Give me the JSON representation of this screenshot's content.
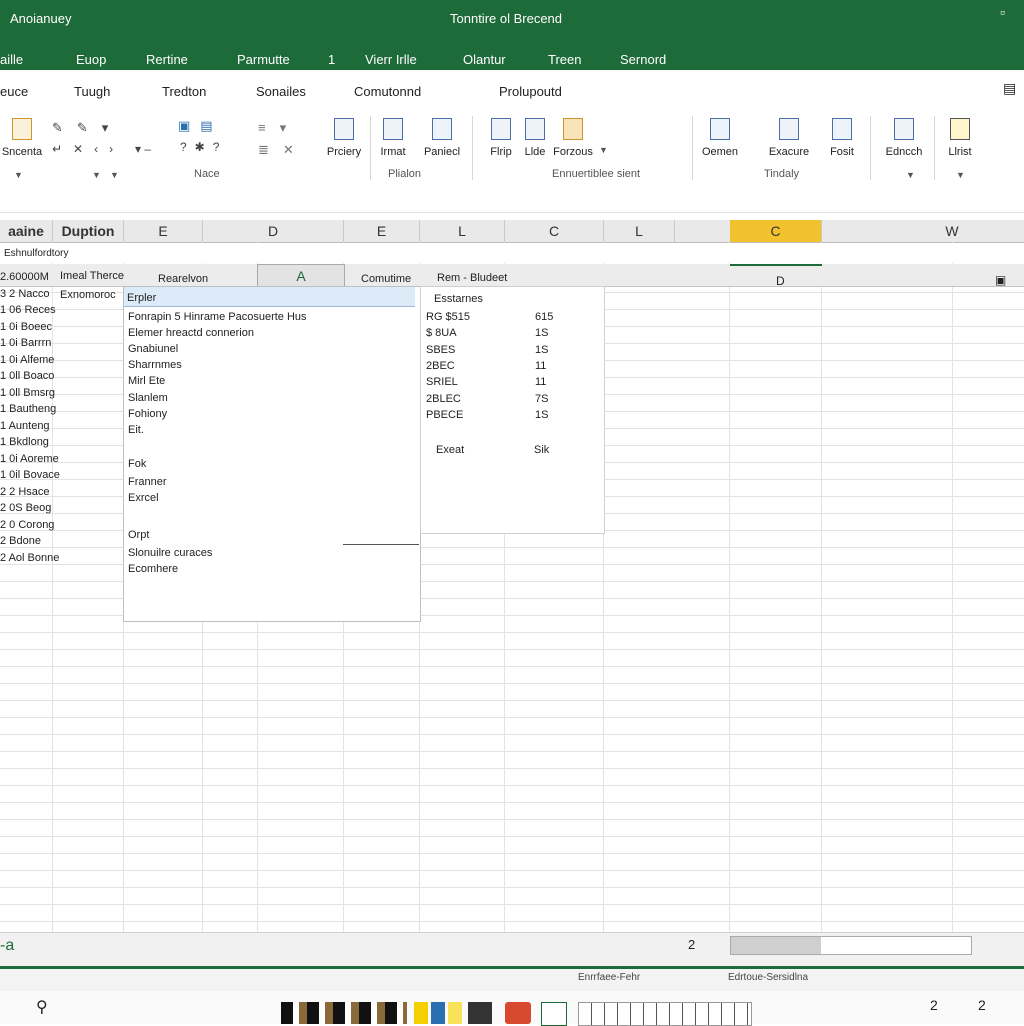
{
  "window": {
    "app_name": "Anoianuey",
    "title": "Tonntire ol Brecend"
  },
  "menu_tabs": [
    "aille",
    "Euop",
    "Rertine",
    "Parmutte",
    "1",
    "Vierr Irlle",
    "Olantur",
    "Treen",
    "Sernord"
  ],
  "ribbon_tabs": [
    "euce",
    "Tuugh",
    "Tredton",
    "Sonailes",
    "Comutonnd",
    "Prolupoutd"
  ],
  "ribbon": {
    "buttons": [
      {
        "label": "Sncenta",
        "icon": "paste-icon"
      },
      {
        "label": "Prciery",
        "icon": "table-icon"
      },
      {
        "label": "Irmat",
        "icon": "format-icon"
      },
      {
        "label": "Paniecl",
        "icon": "panel-icon"
      },
      {
        "label": "Flrip",
        "icon": "chart-icon"
      },
      {
        "label": "Llde",
        "icon": "chart-bars-icon"
      },
      {
        "label": "Forzous",
        "icon": "folder-icon"
      },
      {
        "label": "Oemen",
        "icon": "document-icon"
      },
      {
        "label": "Exacure",
        "icon": "grid-icon"
      },
      {
        "label": "Fosit",
        "icon": "sheet-icon"
      },
      {
        "label": "Edncch",
        "icon": "page-icon"
      },
      {
        "label": "Llrist",
        "icon": "note-icon"
      }
    ],
    "groups": [
      "Nace",
      "Plialon",
      "Ennuertiblee sient",
      "Tindaly"
    ]
  },
  "name_box": "Eshnulfordtory",
  "column_headers": [
    "aaine",
    "Duption",
    "E",
    "D",
    "E",
    "L",
    "C",
    "L",
    "C",
    "W"
  ],
  "subheaders": {
    "a": "Imeal Therce",
    "b": "Rearelvon",
    "c": "A",
    "d": "Comutime",
    "e": "Rem - Bludeet",
    "f": "D"
  },
  "row_labels": [
    "2.60000M",
    "3 2 Nacco",
    "1 06 Reces",
    "1 0i Boeec",
    "1 0i Barrrn",
    "1 0i Alfeme",
    "1 0ll Boaco",
    "1 0ll Bmsrg",
    "1 Bautheng",
    "1 Aunteng",
    "1 Bkdlong",
    "1 0i Aoreme",
    "1 0il Bovace",
    "2 2 Hsace",
    "2 0S Beog",
    "2 0 Corong",
    "2 Bdone",
    "2 Aol Bonne"
  ],
  "row2_label": "Exnomoroc",
  "popup": {
    "header": "Erpler",
    "items": [
      "Fonrapin 5 Hinrame Pacosuerte Hus",
      "Elemer hreactd connerion",
      "Gnabiunel",
      "Sharrnmes",
      "Mirl Ete",
      "Slanlem",
      "Fohiony",
      "Eit.",
      "Fok",
      "Franner",
      "Exrcel",
      "Orpt",
      "Slonuilre curaces",
      "Ecomhere"
    ]
  },
  "panel2": {
    "header": "Esstarnes",
    "rows": [
      {
        "a": "RG $515",
        "b": "615"
      },
      {
        "a": "$ 8UA",
        "b": "1S"
      },
      {
        "a": "SBES",
        "b": "1S"
      },
      {
        "a": "2BEC",
        "b": "11"
      },
      {
        "a": "SRIEL",
        "b": "11"
      },
      {
        "a": "2BLEC",
        "b": "7S"
      },
      {
        "a": "PBECE",
        "b": "1S"
      }
    ],
    "footer_left": "Exeat",
    "footer_right": "Sik"
  },
  "sheet_tab": "a",
  "page_number": "2",
  "status_left": "Enrrfaee-Fehr",
  "status_right": "Edrtoue-Sersidlna",
  "taskbar_left_icon": "search-icon",
  "taskbar_right": [
    "2",
    "2"
  ]
}
